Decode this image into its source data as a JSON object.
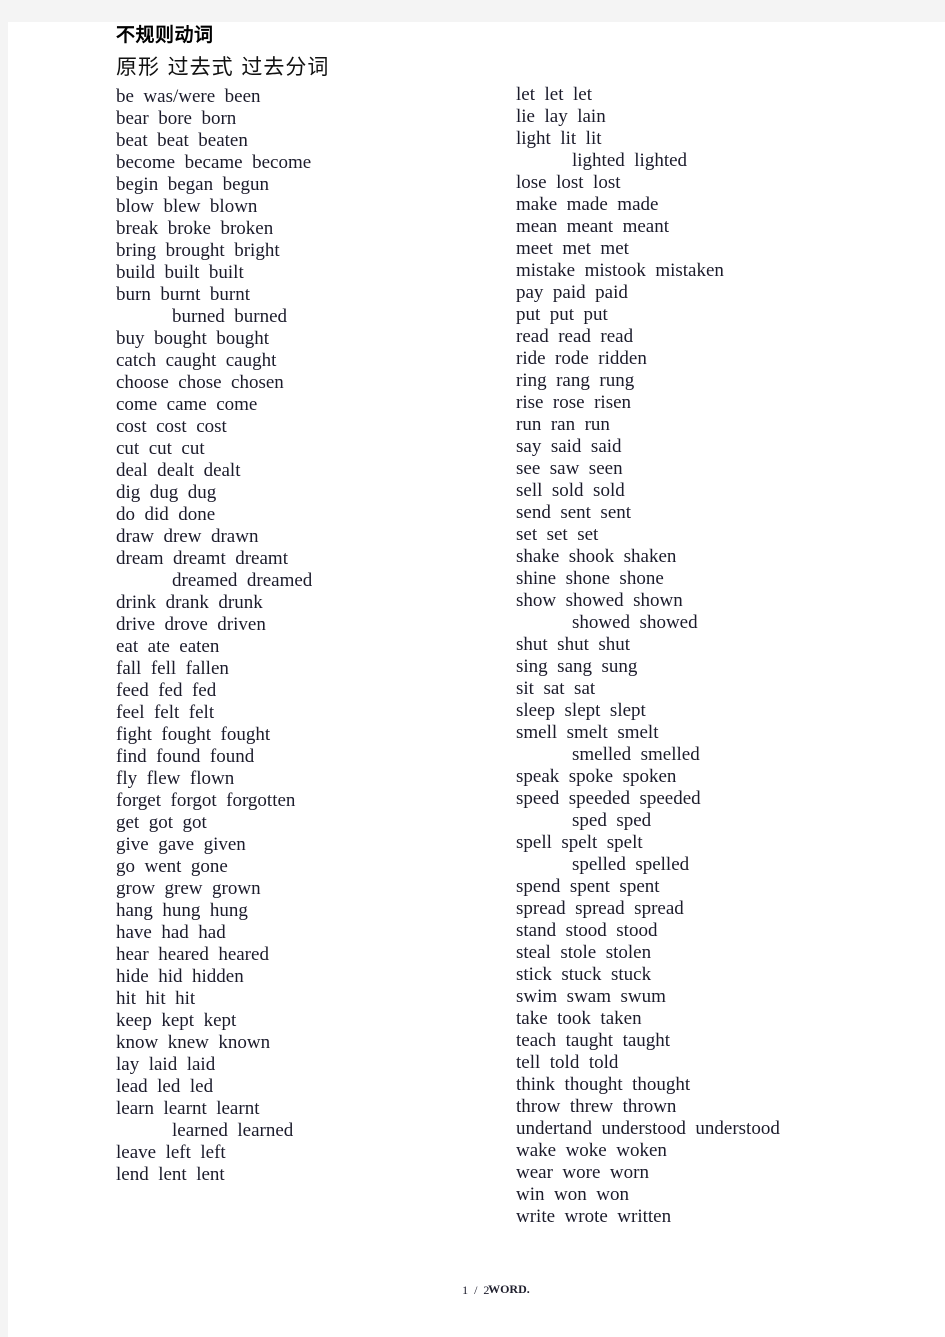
{
  "document": {
    "title": "不规则动词",
    "subtitle": "原形 过去式 过去分词"
  },
  "footer": {
    "pager": "1 / 2",
    "watermark": "WORD."
  },
  "columns": [
    {
      "name": "left-column",
      "lines": [
        {
          "text": "be  was/were  been",
          "alt": false
        },
        {
          "text": "bear  bore  born",
          "alt": false
        },
        {
          "text": "beat  beat  beaten",
          "alt": false
        },
        {
          "text": "become  became  become",
          "alt": false
        },
        {
          "text": "begin  began  begun",
          "alt": false
        },
        {
          "text": "blow  blew  blown",
          "alt": false
        },
        {
          "text": "break  broke  broken",
          "alt": false
        },
        {
          "text": "bring  brought  bright",
          "alt": false
        },
        {
          "text": "build  built  built",
          "alt": false
        },
        {
          "text": "burn  burnt  burnt",
          "alt": false
        },
        {
          "text": "burned  burned",
          "alt": true
        },
        {
          "text": "buy  bought  bought",
          "alt": false
        },
        {
          "text": "catch  caught  caught",
          "alt": false
        },
        {
          "text": "choose  chose  chosen",
          "alt": false
        },
        {
          "text": "come  came  come",
          "alt": false
        },
        {
          "text": "cost  cost  cost",
          "alt": false
        },
        {
          "text": "cut  cut  cut",
          "alt": false
        },
        {
          "text": "deal  dealt  dealt",
          "alt": false
        },
        {
          "text": "dig  dug  dug",
          "alt": false
        },
        {
          "text": "do  did  done",
          "alt": false
        },
        {
          "text": "draw  drew  drawn",
          "alt": false
        },
        {
          "text": "dream  dreamt  dreamt",
          "alt": false
        },
        {
          "text": "dreamed  dreamed",
          "alt": true
        },
        {
          "text": "drink  drank  drunk",
          "alt": false
        },
        {
          "text": "drive  drove  driven",
          "alt": false
        },
        {
          "text": "eat  ate  eaten",
          "alt": false
        },
        {
          "text": "fall  fell  fallen",
          "alt": false
        },
        {
          "text": "feed  fed  fed",
          "alt": false
        },
        {
          "text": "feel  felt  felt",
          "alt": false
        },
        {
          "text": "fight  fought  fought",
          "alt": false
        },
        {
          "text": "find  found  found",
          "alt": false
        },
        {
          "text": "fly  flew  flown",
          "alt": false
        },
        {
          "text": "forget  forgot  forgotten",
          "alt": false
        },
        {
          "text": "get  got  got",
          "alt": false
        },
        {
          "text": "give  gave  given",
          "alt": false
        },
        {
          "text": "go  went  gone",
          "alt": false
        },
        {
          "text": "grow  grew  grown",
          "alt": false
        },
        {
          "text": "hang  hung  hung",
          "alt": false
        },
        {
          "text": "have  had  had",
          "alt": false
        },
        {
          "text": "hear  heared  heared",
          "alt": false
        },
        {
          "text": "hide  hid  hidden",
          "alt": false
        },
        {
          "text": "hit  hit  hit",
          "alt": false
        },
        {
          "text": "keep  kept  kept",
          "alt": false
        },
        {
          "text": "know  knew  known",
          "alt": false
        },
        {
          "text": "lay  laid  laid",
          "alt": false
        },
        {
          "text": "lead  led  led",
          "alt": false
        },
        {
          "text": "learn  learnt  learnt",
          "alt": false
        },
        {
          "text": "learned  learned",
          "alt": true
        },
        {
          "text": "leave  left  left",
          "alt": false
        },
        {
          "text": "lend  lent  lent",
          "alt": false
        }
      ]
    },
    {
      "name": "right-column",
      "lines": [
        {
          "text": "let  let  let",
          "alt": false
        },
        {
          "text": "lie  lay  lain",
          "alt": false
        },
        {
          "text": "light  lit  lit",
          "alt": false
        },
        {
          "text": "lighted  lighted",
          "alt": true
        },
        {
          "text": "lose  lost  lost",
          "alt": false
        },
        {
          "text": "make  made  made",
          "alt": false
        },
        {
          "text": "mean  meant  meant",
          "alt": false
        },
        {
          "text": "meet  met  met",
          "alt": false
        },
        {
          "text": "mistake  mistook  mistaken",
          "alt": false
        },
        {
          "text": "pay  paid  paid",
          "alt": false
        },
        {
          "text": "put  put  put",
          "alt": false
        },
        {
          "text": "read  read  read",
          "alt": false
        },
        {
          "text": "ride  rode  ridden",
          "alt": false
        },
        {
          "text": "ring  rang  rung",
          "alt": false
        },
        {
          "text": "rise  rose  risen",
          "alt": false
        },
        {
          "text": "run  ran  run",
          "alt": false
        },
        {
          "text": "say  said  said",
          "alt": false
        },
        {
          "text": "see  saw  seen",
          "alt": false
        },
        {
          "text": "sell  sold  sold",
          "alt": false
        },
        {
          "text": "send  sent  sent",
          "alt": false
        },
        {
          "text": "set  set  set",
          "alt": false
        },
        {
          "text": "shake  shook  shaken",
          "alt": false
        },
        {
          "text": "shine  shone  shone",
          "alt": false
        },
        {
          "text": "show  showed  shown",
          "alt": false
        },
        {
          "text": "showed  showed",
          "alt": true
        },
        {
          "text": "shut  shut  shut",
          "alt": false
        },
        {
          "text": "sing  sang  sung",
          "alt": false
        },
        {
          "text": "sit  sat  sat",
          "alt": false
        },
        {
          "text": "sleep  slept  slept",
          "alt": false
        },
        {
          "text": "smell  smelt  smelt",
          "alt": false
        },
        {
          "text": "smelled  smelled",
          "alt": true
        },
        {
          "text": "speak  spoke  spoken",
          "alt": false
        },
        {
          "text": "speed  speeded  speeded",
          "alt": false
        },
        {
          "text": "sped  sped",
          "alt": true
        },
        {
          "text": "spell  spelt  spelt",
          "alt": false
        },
        {
          "text": "spelled  spelled",
          "alt": true
        },
        {
          "text": "spend  spent  spent",
          "alt": false
        },
        {
          "text": "spread  spread  spread",
          "alt": false
        },
        {
          "text": "stand  stood  stood",
          "alt": false
        },
        {
          "text": "steal  stole  stolen",
          "alt": false
        },
        {
          "text": "stick  stuck  stuck",
          "alt": false
        },
        {
          "text": "swim  swam  swum",
          "alt": false
        },
        {
          "text": "take  took  taken",
          "alt": false
        },
        {
          "text": "teach  taught  taught",
          "alt": false
        },
        {
          "text": "tell  told  told",
          "alt": false
        },
        {
          "text": "think  thought  thought",
          "alt": false
        },
        {
          "text": "throw  threw  thrown",
          "alt": false
        },
        {
          "text": "undertand  understood  understood",
          "alt": false
        },
        {
          "text": "wake  woke  woken",
          "alt": false
        },
        {
          "text": "wear  wore  worn",
          "alt": false
        },
        {
          "text": "win  won  won",
          "alt": false
        },
        {
          "text": "write  wrote  written",
          "alt": false
        }
      ]
    }
  ]
}
